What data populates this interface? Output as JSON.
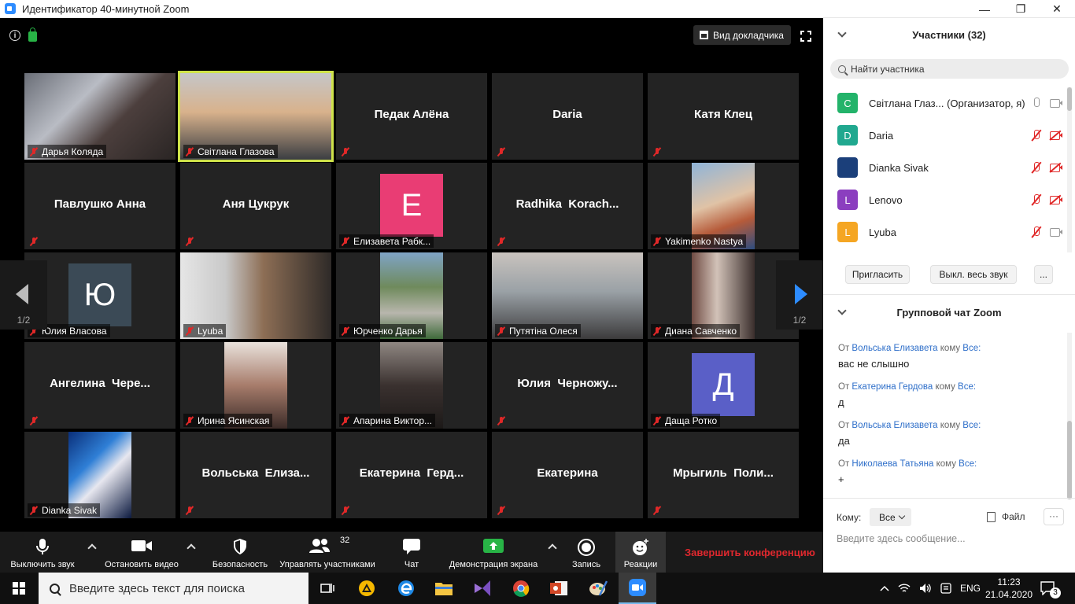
{
  "window": {
    "title": "Идентификатор 40-минутной Zoom",
    "minimize": "—",
    "maximize": "❐",
    "close": "✕"
  },
  "meeting": {
    "speaker_view_label": "Вид докладчика",
    "page_indicator_left": "1/2",
    "page_indicator_right": "1/2"
  },
  "tiles": [
    {
      "name": "Дарья Коляда",
      "type": "video"
    },
    {
      "name": "Світлана Глазова",
      "type": "video",
      "active": true
    },
    {
      "name": "Педак Алёна",
      "type": "name"
    },
    {
      "name": "Daria",
      "type": "name"
    },
    {
      "name": "Катя Клец",
      "type": "name"
    },
    {
      "name": "Павлушко Анна",
      "type": "name"
    },
    {
      "name": "Аня Цукрук",
      "type": "name"
    },
    {
      "name": "Елизавета Рабк...",
      "type": "avatar",
      "letter": "E",
      "color": "#e93d74"
    },
    {
      "name": "Radhika  Korach...",
      "type": "name"
    },
    {
      "name": "Yakimenko Nastya",
      "type": "photo"
    },
    {
      "name": "Юлия Власова",
      "type": "avatar",
      "letter": "Ю",
      "color": "#3b4a56"
    },
    {
      "name": "Lyuba",
      "type": "video"
    },
    {
      "name": "Юрченко Дарья",
      "type": "photo"
    },
    {
      "name": "Путятіна Олеся",
      "type": "video"
    },
    {
      "name": "Диана Савченко",
      "type": "video"
    },
    {
      "name": "Ангелина  Чере...",
      "type": "name"
    },
    {
      "name": "Ирина Ясинская",
      "type": "video"
    },
    {
      "name": "Апарина Виктор...",
      "type": "video"
    },
    {
      "name": "Юлия  Черножу...",
      "type": "name"
    },
    {
      "name": "Даща Ротко",
      "type": "avatar",
      "letter": "Д",
      "color": "#5a5fc7"
    },
    {
      "name": "Dianka Sivak",
      "type": "photo"
    },
    {
      "name": "Вольська  Елиза...",
      "type": "name"
    },
    {
      "name": "Екатерина  Герд...",
      "type": "name"
    },
    {
      "name": "Екатерина",
      "type": "name"
    },
    {
      "name": "Мрыгиль  Поли...",
      "type": "name"
    }
  ],
  "toolbar": {
    "mute": "Выключить звук",
    "stop_video": "Остановить видео",
    "security": "Безопасность",
    "participants": "Управлять участниками",
    "participants_count": "32",
    "chat": "Чат",
    "share": "Демонстрация экрана",
    "record": "Запись",
    "reactions": "Реакции",
    "end": "Завершить конференцию"
  },
  "participants_panel": {
    "title": "Участники (32)",
    "search_placeholder": "Найти участника",
    "items": [
      {
        "letter": "С",
        "color": "#23b36a",
        "name": "Світлана Глаз... (Организатор, я)",
        "mic": "on",
        "cam": "on"
      },
      {
        "letter": "D",
        "color": "#20a88f",
        "name": "Daria",
        "mic": "off",
        "cam": "off"
      },
      {
        "letter": "",
        "color": "#1b3f7a",
        "name": "Dianka Sivak",
        "mic": "off",
        "cam": "off"
      },
      {
        "letter": "L",
        "color": "#8b3ebf",
        "name": "Lenovo",
        "mic": "off",
        "cam": "off"
      },
      {
        "letter": "L",
        "color": "#f5a623",
        "name": "Lyuba",
        "mic": "off",
        "cam": "on"
      }
    ],
    "invite": "Пригласить",
    "mute_all": "Выкл. весь звук",
    "more": "..."
  },
  "chat_panel": {
    "title": "Групповой чат Zoom",
    "messages": [
      {
        "from_label": "От",
        "from": "Вольська Елизавета",
        "to_label": "кому",
        "to": "Все:",
        "text": "вас не слышно"
      },
      {
        "from_label": "От",
        "from": "Екатерина Гердова",
        "to_label": "кому",
        "to": "Все:",
        "text": "д"
      },
      {
        "from_label": "От",
        "from": "Вольська Елизавета",
        "to_label": "кому",
        "to": "Все:",
        "text": "да"
      },
      {
        "from_label": "От",
        "from": "Николаева Татьяна",
        "to_label": "кому",
        "to": "Все:",
        "text": "+"
      }
    ],
    "to_label": "Кому:",
    "to_value": "Все",
    "file_label": "Файл",
    "more": "···",
    "input_placeholder": "Введите здесь сообщение..."
  },
  "taskbar": {
    "search_placeholder": "Введите здесь текст для поиска",
    "lang": "ENG",
    "time": "11:23",
    "date": "21.04.2020",
    "notifications": "3"
  }
}
